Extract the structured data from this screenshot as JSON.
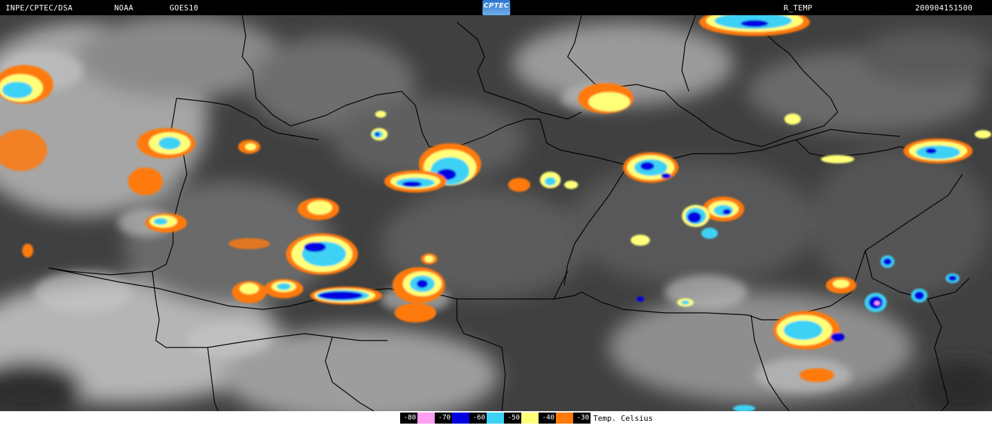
{
  "header": {
    "source": "INPE/CPTEC/DSA",
    "agency": "NOAA",
    "satellite": "GOES10",
    "logo_text": "CPTEC",
    "product": "R_TEMP",
    "timestamp": "200904151500"
  },
  "legend": {
    "items": [
      {
        "label": "-80",
        "color": "#ff9ff0"
      },
      {
        "label": "-70",
        "color": "#0000e0"
      },
      {
        "label": "-60",
        "color": "#3cd2f5"
      },
      {
        "label": "-50",
        "color": "#ffff78"
      },
      {
        "label": "-40",
        "color": "#ff7a0a"
      },
      {
        "label": "-30",
        "color": ""
      }
    ],
    "unit": "Temp. Celsius"
  },
  "colors": {
    "background": "#3e3e3e",
    "cloud": "#bdbdbd",
    "border_line": "#000000"
  }
}
